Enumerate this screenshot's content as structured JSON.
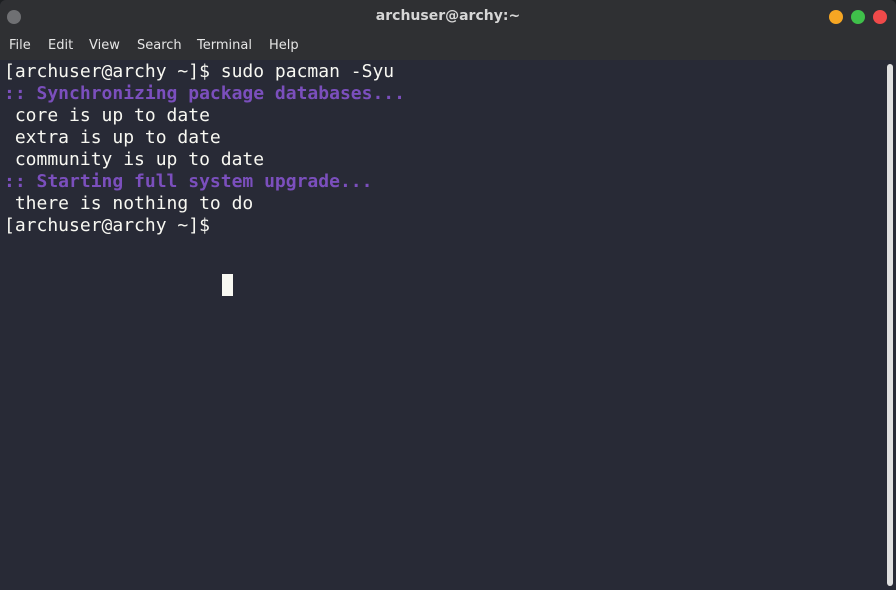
{
  "window": {
    "title": "archuser@archy:~"
  },
  "menu": {
    "file": "File",
    "edit": "Edit",
    "view": "View",
    "search": "Search",
    "terminal": "Terminal",
    "help": "Help"
  },
  "terminal": {
    "lines": [
      "[archuser@archy ~]$ sudo pacman -Syu",
      ":: Synchronizing package databases...",
      " core is up to date",
      " extra is up to date",
      " community is up to date",
      ":: Starting full system upgrade...",
      " there is nothing to do",
      "[archuser@archy ~]$ "
    ]
  },
  "colors": {
    "terminal_bg": "#282a36",
    "terminal_fg": "#f8f8f2",
    "highlight": "#7b4fbd",
    "titlebar": "#2f3033",
    "btn_min": "#f6a623",
    "btn_max": "#3fc04a",
    "btn_close": "#f04a4a"
  }
}
